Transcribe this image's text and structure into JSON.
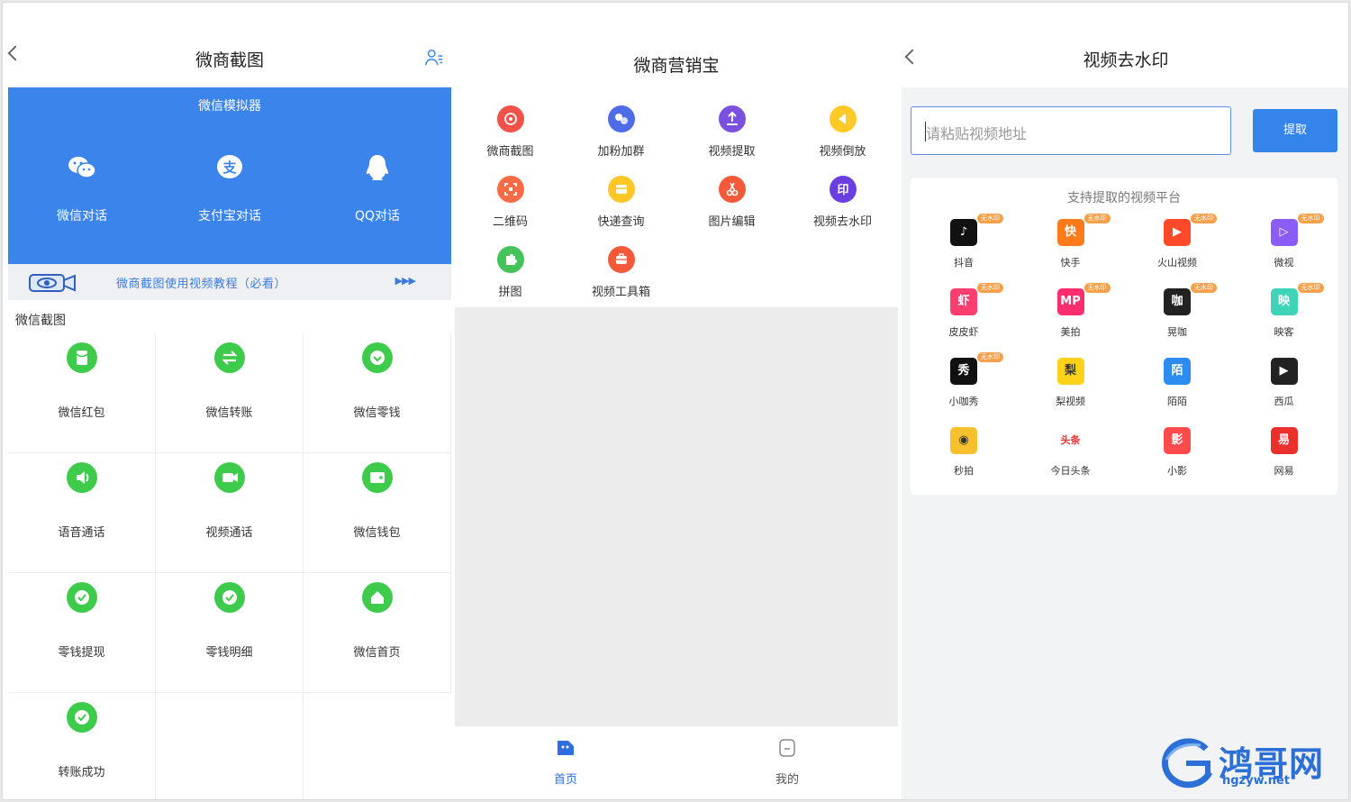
{
  "panel1": {
    "title": "微商截图",
    "simulator": {
      "title": "微信模拟器",
      "items": [
        {
          "label": "微信对话",
          "icon": "wechat-icon"
        },
        {
          "label": "支付宝对话",
          "icon": "alipay-icon"
        },
        {
          "label": "QQ对话",
          "icon": "qq-icon"
        }
      ]
    },
    "banner_text": "微商截图使用视频教程（必看）",
    "banner_arrows": "▶▶▶",
    "section_label": "微信截图",
    "grid": [
      {
        "label": "微信红包",
        "icon": "red-packet-icon"
      },
      {
        "label": "微信转账",
        "icon": "transfer-icon"
      },
      {
        "label": "微信零钱",
        "icon": "change-icon"
      },
      {
        "label": "语音通话",
        "icon": "voice-call-icon"
      },
      {
        "label": "视频通话",
        "icon": "video-call-icon"
      },
      {
        "label": "微信钱包",
        "icon": "wallet-icon"
      },
      {
        "label": "零钱提现",
        "icon": "withdraw-icon"
      },
      {
        "label": "零钱明细",
        "icon": "details-icon"
      },
      {
        "label": "微信首页",
        "icon": "home-icon"
      },
      {
        "label": "转账成功",
        "icon": "success-icon"
      }
    ],
    "accent": "#3b84ec",
    "green": "#3ecb4c"
  },
  "panel2": {
    "title": "微商营销宝",
    "tools": [
      {
        "label": "微商截图",
        "color": "#f0524a",
        "icon": "screenshot-icon"
      },
      {
        "label": "加粉加群",
        "color": "#4f6ce8",
        "icon": "add-fans-icon"
      },
      {
        "label": "视频提取",
        "color": "#7b4fe0",
        "icon": "upload-icon"
      },
      {
        "label": "视频倒放",
        "color": "#ffc928",
        "icon": "rewind-icon"
      },
      {
        "label": "二维码",
        "color": "#f76b47",
        "icon": "qrcode-icon"
      },
      {
        "label": "快递查询",
        "color": "#ffc628",
        "icon": "express-icon"
      },
      {
        "label": "图片编辑",
        "color": "#f45a3a",
        "icon": "scissors-icon"
      },
      {
        "label": "视频去水印",
        "color": "#6a3ee0",
        "icon": "stamp-icon"
      },
      {
        "label": "拼图",
        "color": "#43c35a",
        "icon": "puzzle-icon"
      },
      {
        "label": "视频工具箱",
        "color": "#f45a3a",
        "icon": "toolbox-icon"
      }
    ],
    "tabs": [
      {
        "label": "首页",
        "active": true,
        "icon": "home-tab-icon"
      },
      {
        "label": "我的",
        "active": false,
        "icon": "mine-tab-icon"
      }
    ],
    "active_color": "#2f6de0"
  },
  "panel3": {
    "title": "视频去水印",
    "input_placeholder": "请粘贴视频地址",
    "button_label": "提取",
    "card_title": "支持提取的视频平台",
    "badge_text": "无水印",
    "platforms": [
      {
        "label": "抖音",
        "color": "#111111",
        "badge": true,
        "glyph": "♪"
      },
      {
        "label": "快手",
        "color": "#ff7a1a",
        "badge": true,
        "glyph": "快"
      },
      {
        "label": "火山视频",
        "color": "#ff4a2a",
        "badge": true,
        "glyph": "▶"
      },
      {
        "label": "微视",
        "color": "#8b5cf6",
        "badge": true,
        "glyph": "▷"
      },
      {
        "label": "皮皮虾",
        "color": "#ff3d6e",
        "badge": true,
        "glyph": "虾"
      },
      {
        "label": "美拍",
        "color": "#ff2d6e",
        "badge": true,
        "glyph": "MP"
      },
      {
        "label": "晃咖",
        "color": "#222222",
        "badge": true,
        "glyph": "咖"
      },
      {
        "label": "映客",
        "color": "#3fd4b8",
        "badge": true,
        "glyph": "映"
      },
      {
        "label": "小咖秀",
        "color": "#111111",
        "badge": true,
        "glyph": "秀"
      },
      {
        "label": "梨视频",
        "color": "#ffd21a",
        "badge": false,
        "glyph": "梨"
      },
      {
        "label": "陌陌",
        "color": "#2d8cf0",
        "badge": false,
        "glyph": "陌"
      },
      {
        "label": "西瓜",
        "color": "#222222",
        "badge": false,
        "glyph": "▶"
      },
      {
        "label": "秒拍",
        "color": "#f7c12e",
        "badge": false,
        "glyph": "◉"
      },
      {
        "label": "今日头条",
        "color": "#ffffff",
        "badge": false,
        "glyph": "头条"
      },
      {
        "label": "小影",
        "color": "#ff4b4b",
        "badge": false,
        "glyph": "影"
      },
      {
        "label": "网易",
        "color": "#e9302a",
        "badge": false,
        "glyph": "易"
      }
    ]
  },
  "watermark": {
    "text": "鸿哥网",
    "url": "hgzyw.net"
  }
}
